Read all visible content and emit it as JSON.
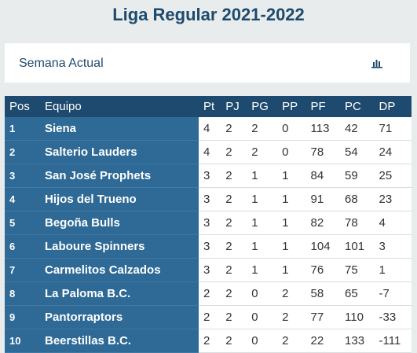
{
  "title": "Liga Regular 2021-2022",
  "week": {
    "label": "Semana Actual",
    "icon": "bar-chart-icon"
  },
  "columns": [
    "Pos",
    "Equipo",
    "Pt",
    "PJ",
    "PG",
    "PP",
    "PF",
    "PC",
    "DP"
  ],
  "rows": [
    {
      "pos": "1",
      "team": "Siena",
      "pt": "4",
      "pj": "2",
      "pg": "2",
      "pp": "0",
      "pf": "113",
      "pc": "42",
      "dp": "71"
    },
    {
      "pos": "2",
      "team": "Salterio Lauders",
      "pt": "4",
      "pj": "2",
      "pg": "2",
      "pp": "0",
      "pf": "78",
      "pc": "54",
      "dp": "24"
    },
    {
      "pos": "3",
      "team": "San José Prophets",
      "pt": "3",
      "pj": "2",
      "pg": "1",
      "pp": "1",
      "pf": "84",
      "pc": "59",
      "dp": "25"
    },
    {
      "pos": "4",
      "team": "Hijos del Trueno",
      "pt": "3",
      "pj": "2",
      "pg": "1",
      "pp": "1",
      "pf": "91",
      "pc": "68",
      "dp": "23"
    },
    {
      "pos": "5",
      "team": "Begoña Bulls",
      "pt": "3",
      "pj": "2",
      "pg": "1",
      "pp": "1",
      "pf": "82",
      "pc": "78",
      "dp": "4"
    },
    {
      "pos": "6",
      "team": "Laboure Spinners",
      "pt": "3",
      "pj": "2",
      "pg": "1",
      "pp": "1",
      "pf": "104",
      "pc": "101",
      "dp": "3"
    },
    {
      "pos": "7",
      "team": "Carmelitos Calzados",
      "pt": "3",
      "pj": "2",
      "pg": "1",
      "pp": "1",
      "pf": "76",
      "pc": "75",
      "dp": "1"
    },
    {
      "pos": "8",
      "team": "La Paloma B.C.",
      "pt": "2",
      "pj": "2",
      "pg": "0",
      "pp": "2",
      "pf": "58",
      "pc": "65",
      "dp": "-7"
    },
    {
      "pos": "9",
      "team": "Pantorraptors",
      "pt": "2",
      "pj": "2",
      "pg": "0",
      "pp": "2",
      "pf": "77",
      "pc": "110",
      "dp": "-33"
    },
    {
      "pos": "10",
      "team": "Beerstillas B.C.",
      "pt": "2",
      "pj": "2",
      "pg": "0",
      "pp": "2",
      "pf": "22",
      "pc": "133",
      "dp": "-111"
    }
  ],
  "colors": {
    "header": "#1d4a6e",
    "team_cell": "#2e6a95",
    "background": "#e9ecec"
  }
}
